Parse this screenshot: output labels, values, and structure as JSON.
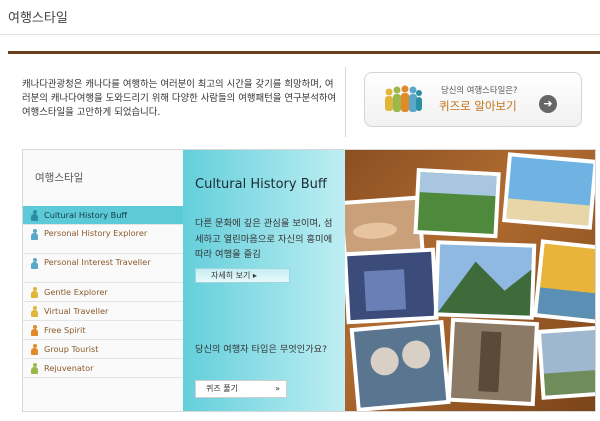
{
  "page": {
    "title": "여행스타일"
  },
  "intro": {
    "text": "캐나다관광청은 캐나다를 여행하는 여러분이 최고의 시간을 갖기를 희망하며, 여러분의 캐나다여행을 도와드리기 위해 다양한 사람들의 여행패턴을 연구분석하여 여행스타일을 고안하게 되었습니다."
  },
  "quiz_banner": {
    "question": "당신의 여행스타일은?",
    "cta": "퀴즈로 알아보기",
    "icon": "people-group-icon"
  },
  "sidebar": {
    "title": "여행스타일",
    "items": [
      {
        "label": "Cultural History Buff",
        "color": "#2a8fa3"
      },
      {
        "label": "Personal History Explorer",
        "color": "#5aa8c8"
      },
      {
        "label": "Personal Interest Traveller",
        "color": "#5aa8c8"
      },
      {
        "label": "Gentle Explorer",
        "color": "#e0b63a"
      },
      {
        "label": "Virtual Traveller",
        "color": "#e0b63a"
      },
      {
        "label": "Free Spirit",
        "color": "#e08a2a"
      },
      {
        "label": "Group Tourist",
        "color": "#e08a2a"
      },
      {
        "label": "Rejuvenator",
        "color": "#9cb84a"
      }
    ]
  },
  "content": {
    "title": "Cultural History Buff",
    "description": "다른 문화에 깊은 관심을 보이며, 섬세하고 열린마음으로 자신의 흥미에 따라 여행을 즐김",
    "details_button": "자세히 보기 ▸",
    "question": "당신의 여행자 타입은 무엇인가요?",
    "quiz_button": "퀴즈 풀기",
    "quiz_arrow": "»"
  }
}
